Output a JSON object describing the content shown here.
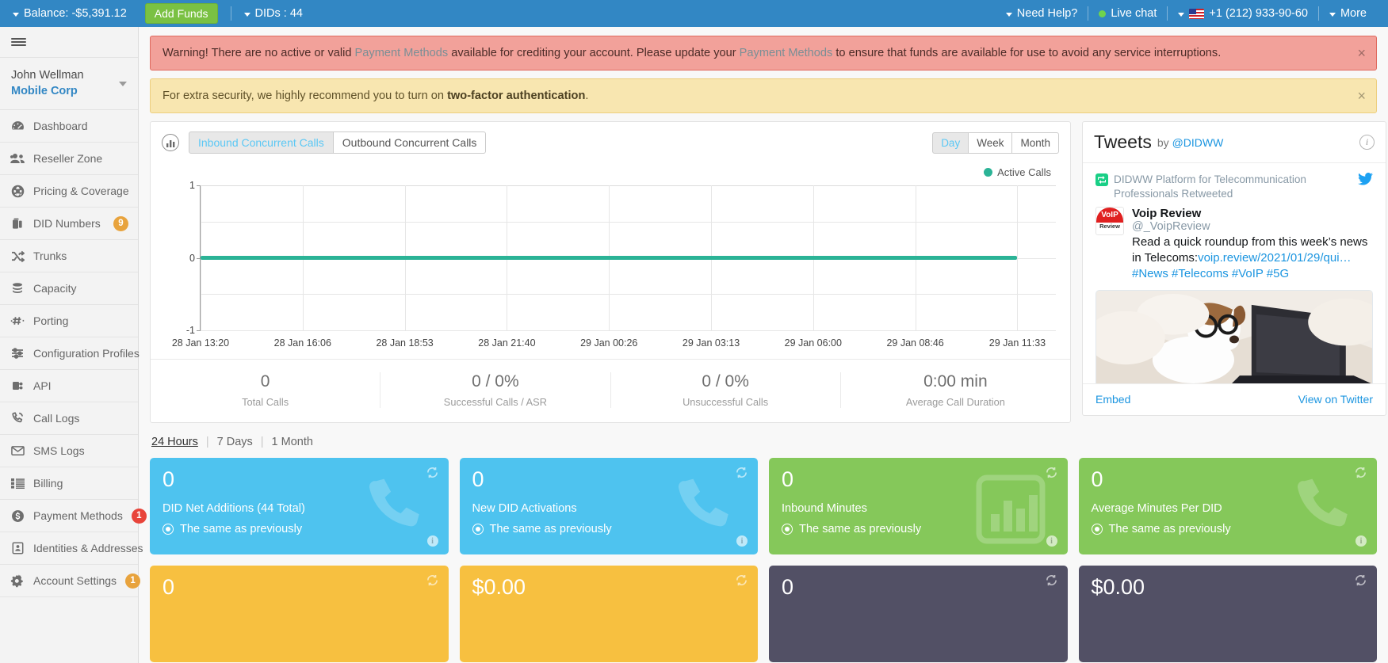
{
  "topbar": {
    "balance_label": "Balance: -$5,391.12",
    "add_funds": "Add Funds",
    "dids_label": "DIDs : 44",
    "need_help": "Need Help?",
    "live_chat": "Live chat",
    "phone": "+1 (212) 933-90-60",
    "more": "More",
    "bg_color": "#3287c4",
    "add_funds_color": "#7ac143"
  },
  "sidebar": {
    "user_name": "John Wellman",
    "user_org": "Mobile Corp",
    "items": [
      {
        "label": "Dashboard",
        "icon": "dashboard-icon",
        "badge": ""
      },
      {
        "label": "Reseller Zone",
        "icon": "users-icon",
        "badge": ""
      },
      {
        "label": "Pricing & Coverage",
        "icon": "globe-icon",
        "badge": ""
      },
      {
        "label": "DID Numbers",
        "icon": "briefcase-icon",
        "badge": "9",
        "badge_color": "amber"
      },
      {
        "label": "Trunks",
        "icon": "shuffle-icon",
        "badge": ""
      },
      {
        "label": "Capacity",
        "icon": "database-icon",
        "badge": ""
      },
      {
        "label": "Porting",
        "icon": "hash-icon",
        "badge": ""
      },
      {
        "label": "Configuration Profiles",
        "icon": "sliders-icon",
        "badge": ""
      },
      {
        "label": "API",
        "icon": "plug-icon",
        "badge": ""
      },
      {
        "label": "Call Logs",
        "icon": "phone-icon",
        "badge": ""
      },
      {
        "label": "SMS Logs",
        "icon": "envelope-icon",
        "badge": ""
      },
      {
        "label": "Billing",
        "icon": "list-icon",
        "badge": ""
      },
      {
        "label": "Payment Methods",
        "icon": "dollar-icon",
        "badge": "1",
        "badge_color": "red"
      },
      {
        "label": "Identities & Addresses",
        "icon": "id-card-icon",
        "badge": ""
      },
      {
        "label": "Account Settings",
        "icon": "gears-icon",
        "badge": "1",
        "badge_color": "amber"
      }
    ]
  },
  "alerts": {
    "danger": {
      "part1": "Warning! There are no active or valid ",
      "link1": "Payment Methods",
      "part2": " available for crediting your account. Please update your ",
      "link2": "Payment Methods",
      "part3": " to ensure that funds are available for use to avoid any service interruptions.",
      "close": "×",
      "bg_color": "#f2a19a"
    },
    "warn": {
      "part1": "For extra security, we highly recommend you to turn on ",
      "bold": "two-factor authentication",
      "part2": ".",
      "close": "×",
      "bg_color": "#f8e6b0"
    }
  },
  "chart_panel": {
    "tabs": [
      {
        "label": "Inbound Concurrent Calls",
        "active": true
      },
      {
        "label": "Outbound Concurrent Calls",
        "active": false
      }
    ],
    "ranges": [
      {
        "label": "Day",
        "active": true
      },
      {
        "label": "Week",
        "active": false
      },
      {
        "label": "Month",
        "active": false
      }
    ],
    "stats": [
      {
        "value": "0",
        "label": "Total Calls"
      },
      {
        "value": "0 / 0%",
        "label": "Successful Calls / ASR"
      },
      {
        "value": "0 / 0%",
        "label": "Unsuccessful Calls"
      },
      {
        "value": "0:00 min",
        "label": "Average Call Duration"
      }
    ]
  },
  "chart_data": {
    "type": "line",
    "title": "Inbound Concurrent Calls",
    "xlabel": "",
    "ylabel": "",
    "ylim": [
      -1,
      1
    ],
    "yticks": [
      "1",
      "0",
      "-1"
    ],
    "ytick_values": [
      1,
      0,
      -1
    ],
    "grid": true,
    "legend_position": "top-right",
    "x": [
      "28 Jan 13:20",
      "28 Jan 16:06",
      "28 Jan 18:53",
      "28 Jan 21:40",
      "29 Jan 00:26",
      "29 Jan 03:13",
      "29 Jan 06:00",
      "29 Jan 08:46",
      "29 Jan 11:33"
    ],
    "series": [
      {
        "name": "Active Calls",
        "color": "#2bb396",
        "values": [
          0,
          0,
          0,
          0,
          0,
          0,
          0,
          0,
          0
        ]
      }
    ]
  },
  "tweets": {
    "title": "Tweets",
    "by_prefix": "by ",
    "handle": "@DIDWW",
    "retweet_text": "DIDWW Platform for Telecommunication Professionals Retweeted",
    "author_name": "Voip Review",
    "author_handle": "@_VoipReview",
    "avatar_top": "VoIP",
    "avatar_bottom": "Review",
    "text_part1": "Read a quick roundup from this week’s news in Telecoms:",
    "link": "voip.review/2021/01/29/qui…",
    "hashtags": "#News #Telecoms #VoIP #5G",
    "embed": "Embed",
    "view_on_twitter": "View on Twitter"
  },
  "periods": [
    {
      "label": "24 Hours",
      "active": true
    },
    {
      "label": "7 Days",
      "active": false
    },
    {
      "label": "1 Month",
      "active": false
    }
  ],
  "cards": [
    {
      "value": "0",
      "label": "DID Net Additions (44 Total)",
      "sub": "The same as previously",
      "color": "blue",
      "bg_icon": "phone-icon"
    },
    {
      "value": "0",
      "label": "New DID Activations",
      "sub": "The same as previously",
      "color": "blue",
      "bg_icon": "phone-icon"
    },
    {
      "value": "0",
      "label": "Inbound Minutes",
      "sub": "The same as previously",
      "color": "green",
      "bg_icon": "bar-chart-icon"
    },
    {
      "value": "0",
      "label": "Average Minutes Per DID",
      "sub": "The same as previously",
      "color": "green",
      "bg_icon": "phone-icon"
    }
  ],
  "cards_row2": [
    {
      "value": "0",
      "color": "amber"
    },
    {
      "value": "$0.00",
      "color": "amber"
    },
    {
      "value": "0",
      "color": "dark"
    },
    {
      "value": "$0.00",
      "color": "dark"
    }
  ]
}
